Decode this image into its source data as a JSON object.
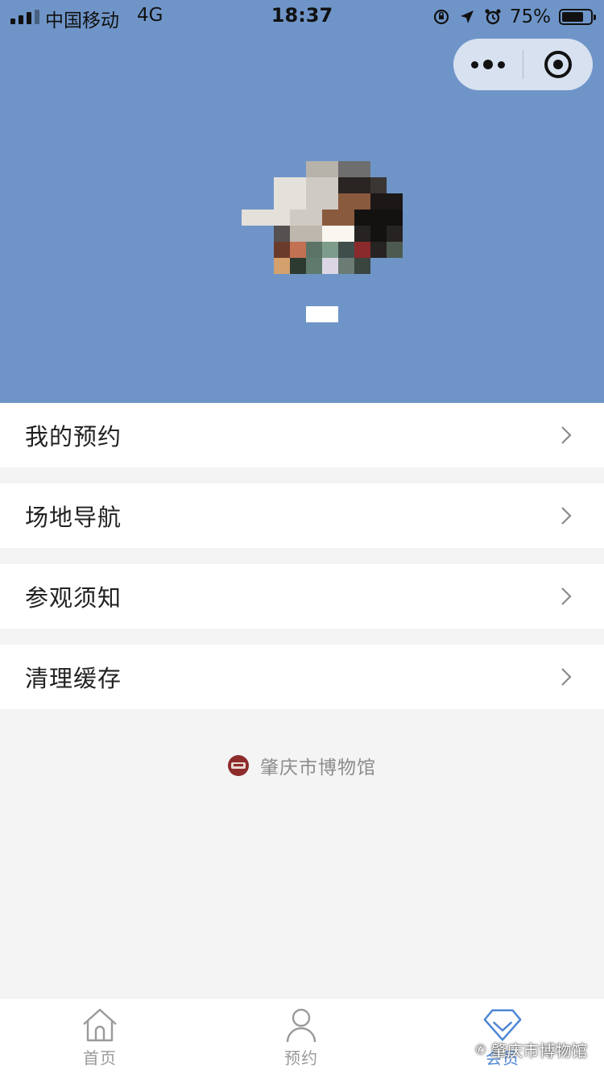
{
  "status_bar": {
    "carrier": "中国移动",
    "network": "4G",
    "time": "18:37",
    "battery_percent": "75%",
    "battery_level": 0.75,
    "icons": [
      "signal-icon",
      "orientation-lock-icon",
      "location-icon",
      "alarm-icon",
      "battery-icon"
    ]
  },
  "capsule": {
    "more_icon": "more-dots-icon",
    "close_icon": "target-close-icon"
  },
  "profile": {
    "avatar_icon": "pixelated-avatar",
    "nickname": ""
  },
  "menu": {
    "items": [
      {
        "label": "我的预约",
        "icon": "chevron-right-icon"
      },
      {
        "label": "场地导航",
        "icon": "chevron-right-icon"
      },
      {
        "label": "参观须知",
        "icon": "chevron-right-icon"
      },
      {
        "label": "清理缓存",
        "icon": "chevron-right-icon"
      }
    ]
  },
  "brand": {
    "name": "肇庆市博物馆",
    "logo_icon": "museum-logo-icon"
  },
  "tabbar": {
    "tabs": [
      {
        "label": "首页",
        "icon": "home-icon",
        "active": false
      },
      {
        "label": "预约",
        "icon": "person-icon",
        "active": false
      },
      {
        "label": "会员",
        "icon": "member-diamond-icon",
        "active": true
      }
    ]
  },
  "watermark": {
    "text": "肇庆市博物馆"
  },
  "colors": {
    "header_bg": "#6f95c8",
    "page_bg": "#f4f4f5",
    "accent": "#4f86d6",
    "tab_inactive": "#9a9a9a",
    "brand_text": "#8c8c8c"
  }
}
